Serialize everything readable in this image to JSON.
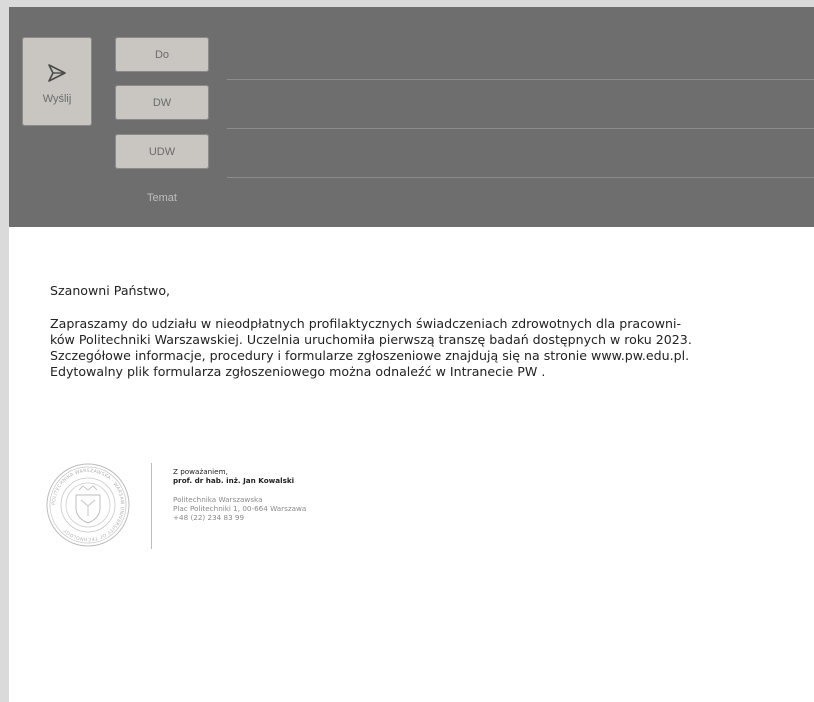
{
  "compose": {
    "send_label": "Wyślij",
    "to_label": "Do",
    "cc_label": "DW",
    "bcc_label": "UDW",
    "subject_label": "Temat"
  },
  "message": {
    "greeting": "Szanowni Państwo,",
    "paragraph_lines": [
      "Zapraszamy do udziału w nieodpłatnych profilaktycznych świadczeniach zdrowotnych dla pracowni-",
      "ków Politechniki Warszawskiej. Uczelnia uruchomiła pierwszą transzę badań dostępnych w roku 2023.",
      "Szczegółowe informacje, procedury i formularze zgłoszeniowe znajdują się na stronie www.pw.edu.pl.",
      "Edytowalny plik formularza zgłoszeniowego można odnaleźć w Intranecie PW ."
    ]
  },
  "signature": {
    "closing": "Z poważaniem,",
    "name": "prof. dr hab. inż. Jan Kowalski",
    "org": "Politechnika Warszawska",
    "address": "Plac Politechniki 1, 00-664 Warszawa",
    "phone": "+48 (22) 234 83 99",
    "seal_text": "POLITECHNIKA WARSZAWSKA · WARSAW UNIVERSITY OF TECHNOLOGY"
  },
  "colors": {
    "header_bg": "#6e6e6e",
    "button_bg": "#c9c6c2",
    "page_bg": "#ffffff"
  },
  "icons": {
    "send": "paper-plane-icon",
    "seal": "university-seal-icon"
  }
}
